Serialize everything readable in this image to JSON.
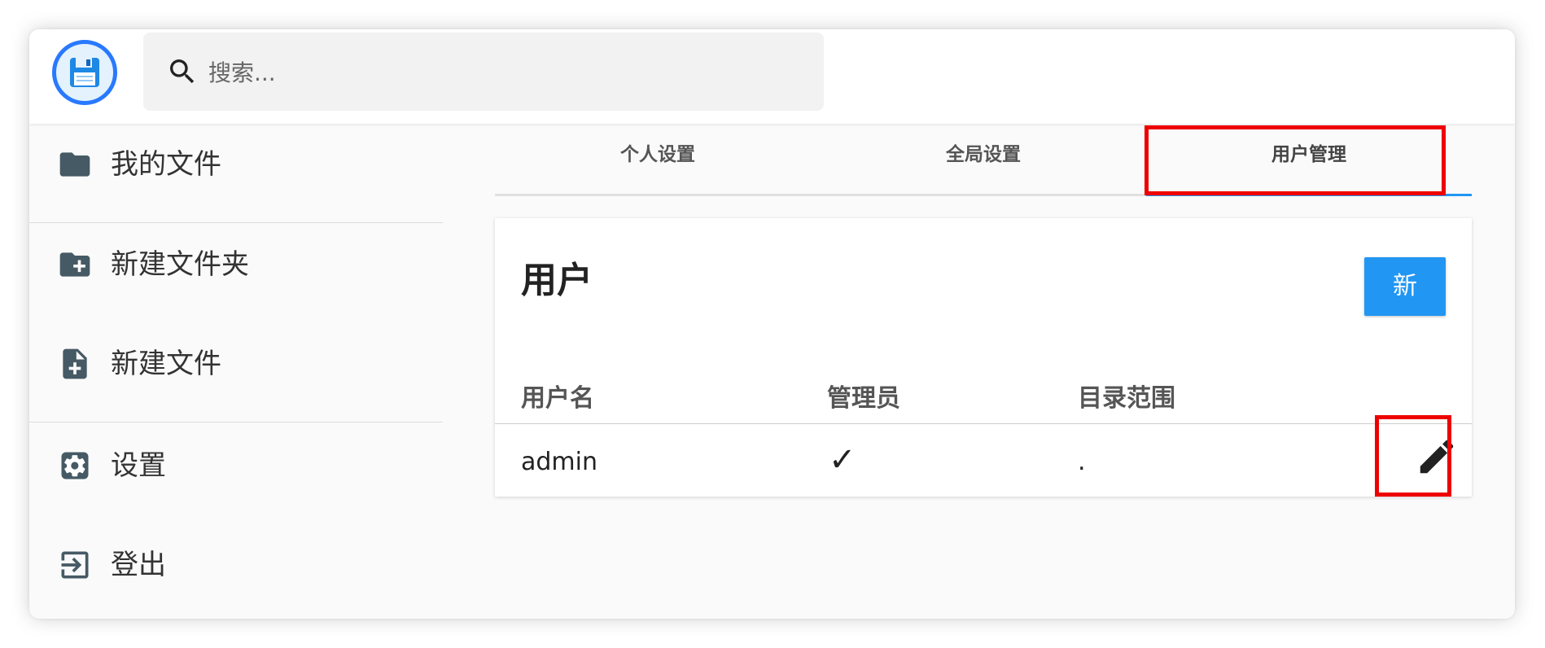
{
  "search": {
    "placeholder": "搜索..."
  },
  "sidebar": {
    "items": [
      {
        "label": "我的文件",
        "icon": "folder-icon"
      },
      {
        "label": "新建文件夹",
        "icon": "create-new-folder-icon"
      },
      {
        "label": "新建文件",
        "icon": "note-add-icon"
      },
      {
        "label": "设置",
        "icon": "settings-icon"
      },
      {
        "label": "登出",
        "icon": "exit-icon"
      }
    ]
  },
  "tabs": [
    {
      "label": "个人设置",
      "active": false
    },
    {
      "label": "全局设置",
      "active": false
    },
    {
      "label": "用户管理",
      "active": true
    }
  ],
  "users_card": {
    "title": "用户",
    "new_button": "新",
    "columns": [
      "用户名",
      "管理员",
      "目录范围"
    ],
    "rows": [
      {
        "username": "admin",
        "admin": "✓",
        "scope": "."
      }
    ]
  },
  "colors": {
    "accent": "#2196f3",
    "highlight": "#ee0000",
    "logo_ring": "#2979ff"
  }
}
